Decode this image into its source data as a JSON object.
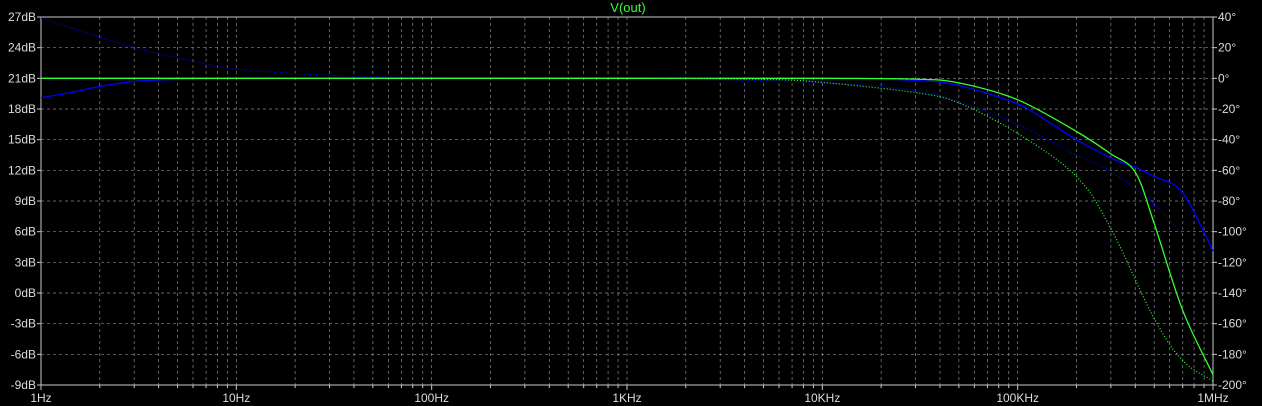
{
  "chart_data": {
    "type": "line",
    "title": "V(out)",
    "x_scale": "log",
    "x_ticks": [
      {
        "value": 1,
        "label": "1Hz"
      },
      {
        "value": 10,
        "label": "10Hz"
      },
      {
        "value": 100,
        "label": "100Hz"
      },
      {
        "value": 1000,
        "label": "1KHz"
      },
      {
        "value": 10000,
        "label": "10KHz"
      },
      {
        "value": 100000,
        "label": "100KHz"
      },
      {
        "value": 1000000,
        "label": "1MHz"
      }
    ],
    "xlim": [
      1,
      1000000
    ],
    "y_left": {
      "unit": "dB",
      "ylim": [
        -9,
        27
      ],
      "ticks": [
        {
          "value": 27,
          "label": "27dB"
        },
        {
          "value": 24,
          "label": "24dB"
        },
        {
          "value": 21,
          "label": "21dB"
        },
        {
          "value": 18,
          "label": "18dB"
        },
        {
          "value": 15,
          "label": "15dB"
        },
        {
          "value": 12,
          "label": "12dB"
        },
        {
          "value": 9,
          "label": "9dB"
        },
        {
          "value": 6,
          "label": "6dB"
        },
        {
          "value": 3,
          "label": "3dB"
        },
        {
          "value": 0,
          "label": "0dB"
        },
        {
          "value": -3,
          "label": "-3dB"
        },
        {
          "value": -6,
          "label": "-6dB"
        },
        {
          "value": -9,
          "label": "-9dB"
        }
      ]
    },
    "y_right": {
      "unit": "°",
      "ylim": [
        -200,
        40
      ],
      "ticks": [
        {
          "value": 40,
          "label": "40°"
        },
        {
          "value": 20,
          "label": "20°"
        },
        {
          "value": 0,
          "label": "0°"
        },
        {
          "value": -20,
          "label": "-20°"
        },
        {
          "value": -40,
          "label": "-40°"
        },
        {
          "value": -60,
          "label": "-60°"
        },
        {
          "value": -80,
          "label": "-80°"
        },
        {
          "value": -100,
          "label": "-100°"
        },
        {
          "value": -120,
          "label": "-120°"
        },
        {
          "value": -140,
          "label": "-140°"
        },
        {
          "value": -160,
          "label": "-160°"
        },
        {
          "value": -180,
          "label": "-180°"
        },
        {
          "value": -200,
          "label": "-200°"
        }
      ]
    },
    "grid": true,
    "series": [
      {
        "color": "#0000ff",
        "style": "solid",
        "axis": "left",
        "x": [
          1,
          1.5,
          2,
          3,
          5,
          10,
          100,
          1000,
          10000,
          30000,
          50000,
          100000,
          150000,
          200000,
          300000,
          400000,
          500000,
          700000,
          1000000
        ],
        "values": [
          19.1,
          19.7,
          20.2,
          20.7,
          20.9,
          21,
          21,
          21,
          21,
          20.8,
          20.3,
          18.5,
          16.5,
          15.0,
          13.2,
          12.3,
          11.4,
          9.8,
          4.1
        ]
      },
      {
        "color": "#0000ff",
        "style": "dotted",
        "axis": "right",
        "x": [
          1,
          2,
          3,
          5,
          10,
          30,
          100,
          1000,
          10000,
          30000,
          50000,
          100000,
          200000,
          300000,
          500000,
          700000
        ],
        "values": [
          39.3,
          27.0,
          20.0,
          13.3,
          6.0,
          2.0,
          0.6,
          0.1,
          -2.7,
          -8.0,
          -15.3,
          -30.0,
          -50.0,
          -60.7,
          -82.0,
          -102.0
        ]
      },
      {
        "color": "#33ff33",
        "style": "solid",
        "axis": "right",
        "x": [
          1,
          10,
          100,
          1000,
          10000,
          30000,
          50000,
          100000,
          200000,
          300000,
          400000,
          500000,
          700000,
          1000000
        ],
        "values": [
          0,
          0,
          0,
          0,
          0,
          -0.5,
          -3.0,
          -14.0,
          -34.7,
          -49.3,
          -61.3,
          -94.7,
          -151.3,
          -193.3
        ]
      },
      {
        "color": "#33ff33",
        "style": "dotted",
        "axis": "left",
        "x": [
          1,
          10,
          100,
          1000,
          5000,
          10000,
          30000,
          50000,
          100000,
          200000,
          300000,
          500000,
          700000,
          1000000
        ],
        "values": [
          21,
          21,
          21,
          21,
          20.9,
          20.6,
          19.6,
          18.6,
          15.6,
          11.4,
          6.3,
          -2.5,
          -6.6,
          -8.6
        ]
      }
    ]
  }
}
